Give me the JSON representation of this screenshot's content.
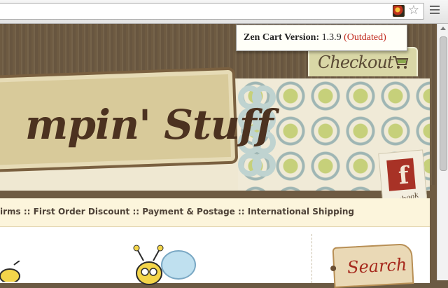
{
  "browser": {
    "extension_icon": "zen-cart-extension-icon",
    "bookmark_icon": "star-icon",
    "menu_icon": "menu-icon"
  },
  "tooltip": {
    "label": "Zen Cart Version:",
    "version": "1.3.9",
    "status": "(Outdated)",
    "status_color": "#c0281c"
  },
  "site": {
    "brand_partial": "mpin' Stuff",
    "checkout_label": "Checkout",
    "facebook_label": "facebook",
    "facebook_letter": "f"
  },
  "nav": {
    "items": [
      "irms",
      "First Order Discount",
      "Payment & Postage",
      "International Shipping"
    ],
    "separator": "::"
  },
  "sidebar": {
    "search_label": "Search"
  },
  "colors": {
    "accent_red": "#a83226",
    "nav_bg": "#fcf5dc",
    "wood_bg": "#6e5b42"
  }
}
